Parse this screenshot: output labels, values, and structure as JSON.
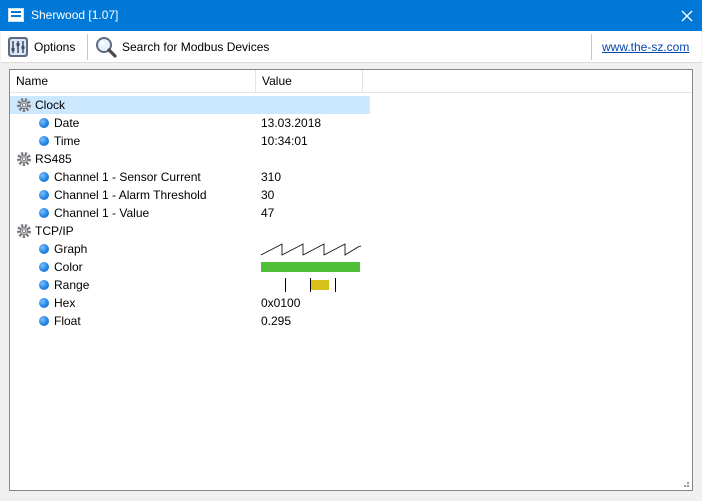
{
  "window": {
    "title": "Sherwood [1.07]"
  },
  "toolbar": {
    "options_label": "Options",
    "search_label": "Search for Modbus Devices",
    "link_text": "www.the-sz.com"
  },
  "columns": {
    "name": "Name",
    "value": "Value"
  },
  "groups": [
    {
      "name": "Clock",
      "selected": true,
      "items": [
        {
          "name": "Date",
          "value": "13.03.2018"
        },
        {
          "name": "Time",
          "value": "10:34:01"
        }
      ]
    },
    {
      "name": "RS485",
      "items": [
        {
          "name": "Channel 1 - Sensor Current",
          "value": "310"
        },
        {
          "name": "Channel 1 - Alarm Threshold",
          "value": "30"
        },
        {
          "name": "Channel 1 - Value",
          "value": "47"
        }
      ]
    },
    {
      "name": "TCP/IP",
      "items": [
        {
          "name": "Graph",
          "widget": "sawtooth-graph"
        },
        {
          "name": "Color",
          "widget": "color-swatch",
          "color": "#4fbf38"
        },
        {
          "name": "Range",
          "widget": "range-indicator",
          "fill_color": "#d9c11b"
        },
        {
          "name": "Hex",
          "value": "0x0100"
        },
        {
          "name": "Float",
          "value": "0.295"
        }
      ]
    }
  ],
  "colors": {
    "titlebar": "#0078d7",
    "selection": "#cce8ff",
    "link": "#0645ad"
  }
}
